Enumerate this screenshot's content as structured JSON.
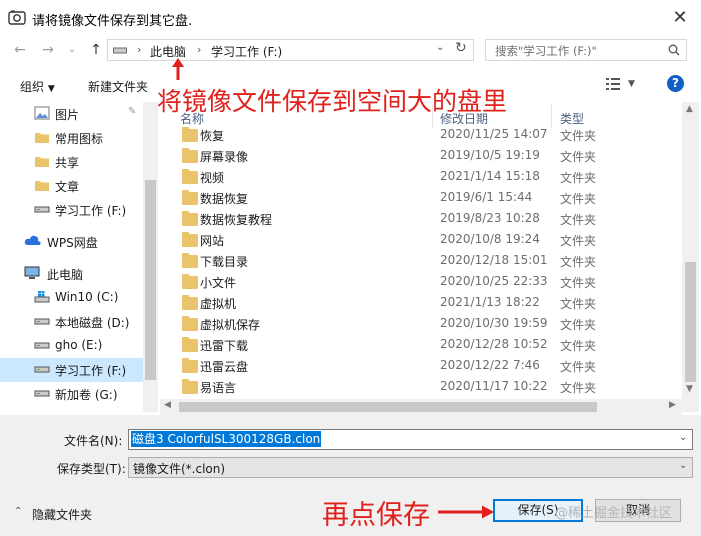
{
  "window": {
    "title": "请将镜像文件保存到其它盘."
  },
  "nav": {
    "breadcrumb": [
      "此电脑",
      "学习工作 (F:)"
    ],
    "search_placeholder": "搜索\"学习工作 (F:)\""
  },
  "toolbar": {
    "organize": "组织",
    "new_folder": "新建文件夹"
  },
  "sidebar": {
    "items": [
      {
        "label": "图片",
        "icon": "pictures-icon"
      },
      {
        "label": "常用图标",
        "icon": "folder-icon"
      },
      {
        "label": "共享",
        "icon": "folder-icon"
      },
      {
        "label": "文章",
        "icon": "folder-icon"
      },
      {
        "label": "学习工作 (F:)",
        "icon": "drive-icon"
      },
      {
        "label": "WPS网盘",
        "icon": "cloud-icon"
      },
      {
        "label": "此电脑",
        "icon": "computer-icon"
      },
      {
        "label": "Win10 (C:)",
        "icon": "windows-drive-icon"
      },
      {
        "label": "本地磁盘 (D:)",
        "icon": "drive-icon"
      },
      {
        "label": "gho (E:)",
        "icon": "drive-icon"
      },
      {
        "label": "学习工作 (F:)",
        "icon": "drive-icon"
      },
      {
        "label": "新加卷 (G:)",
        "icon": "drive-icon"
      }
    ]
  },
  "columns": {
    "name": "名称",
    "date": "修改日期",
    "type": "类型"
  },
  "files": [
    {
      "name": "恢复",
      "date": "2020/11/25 14:07",
      "type": "文件夹"
    },
    {
      "name": "屏幕录像",
      "date": "2019/10/5 19:19",
      "type": "文件夹"
    },
    {
      "name": "视频",
      "date": "2021/1/14 15:18",
      "type": "文件夹"
    },
    {
      "name": "数据恢复",
      "date": "2019/6/1 15:44",
      "type": "文件夹"
    },
    {
      "name": "数据恢复教程",
      "date": "2019/8/23 10:28",
      "type": "文件夹"
    },
    {
      "name": "网站",
      "date": "2020/10/8 19:24",
      "type": "文件夹"
    },
    {
      "name": "下载目录",
      "date": "2020/12/18 15:01",
      "type": "文件夹"
    },
    {
      "name": "小文件",
      "date": "2020/10/25 22:33",
      "type": "文件夹"
    },
    {
      "name": "虚拟机",
      "date": "2021/1/13 18:22",
      "type": "文件夹"
    },
    {
      "name": "虚拟机保存",
      "date": "2020/10/30 19:59",
      "type": "文件夹"
    },
    {
      "name": "迅雷下载",
      "date": "2020/12/28 10:52",
      "type": "文件夹"
    },
    {
      "name": "迅雷云盘",
      "date": "2020/12/22 7:46",
      "type": "文件夹"
    },
    {
      "name": "易语言",
      "date": "2020/11/17 10:22",
      "type": "文件夹"
    }
  ],
  "form": {
    "filename_label": "文件名(N):",
    "filename_value": "磁盘3 ColorfulSL300128GB.clon",
    "filetype_label": "保存类型(T):",
    "filetype_value": "镜像文件(*.clon)"
  },
  "footer": {
    "hide_folders": "隐藏文件夹",
    "save": "保存(S)",
    "cancel": "取消"
  },
  "annotations": {
    "top": "将镜像文件保存到空间大的盘里",
    "bottom": "再点保存"
  },
  "watermark": "@稀土掘金技术社区",
  "colors": {
    "annotation": "#e0201b",
    "accent": "#0078d7",
    "folder": "#e9c46a"
  }
}
